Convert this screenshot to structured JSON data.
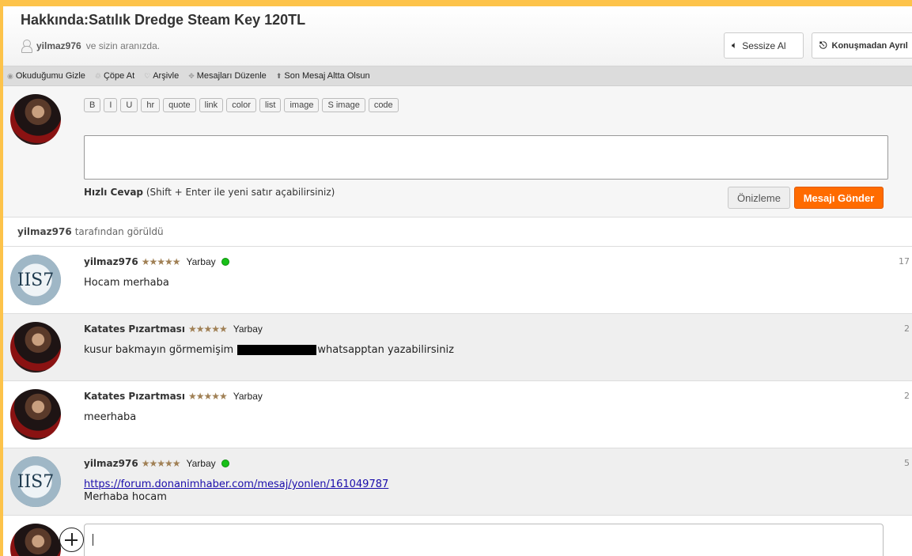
{
  "header": {
    "title": "Hakkında:Satılık Dredge Steam Key 120TL",
    "participant_user": "yilmaz976",
    "participant_suffix": "ve sizin aranızda.",
    "mute_label": "Sessize Al",
    "leave_label": "Konuşmadan Ayrıl"
  },
  "toolbar": {
    "items": [
      {
        "label": "Okuduğumu Gizle",
        "icon": "eye-icon"
      },
      {
        "label": "Çöpe At",
        "icon": "trash-icon"
      },
      {
        "label": "Arşivle",
        "icon": "archive-icon"
      },
      {
        "label": "Mesajları Düzenle",
        "icon": "move-icon"
      },
      {
        "label": "Son Mesaj Altta Olsun",
        "icon": "arrow-up-icon"
      }
    ]
  },
  "composer": {
    "format_buttons": [
      "B",
      "I",
      "U",
      "hr",
      "quote",
      "link",
      "color",
      "list",
      "image",
      "S image",
      "code"
    ],
    "hint_bold": "Hızlı Cevap",
    "hint_rest": "(Shift + Enter ile yeni satır açabilirsiniz)",
    "preview_label": "Önizleme",
    "send_label": "Mesajı Gönder"
  },
  "seen": {
    "user": "yilmaz976",
    "suffix": "tarafından görüldü"
  },
  "messages": [
    {
      "user": "yilmaz976",
      "stars": "★★★★★",
      "rank": "Yarbay",
      "time": "17",
      "body": "Hocam merhaba",
      "online": true
    },
    {
      "user": "Katates Pızartması",
      "stars": "★★★★★",
      "rank": "Yarbay",
      "time": "2",
      "body_before": "kusur bakmayın görmemişim",
      "body_after": "whatsapptan  yazabilirsiniz",
      "online": false
    },
    {
      "user": "Katates Pızartması",
      "stars": "★★★★★",
      "rank": "Yarbay",
      "time": "2",
      "body": "meerhaba",
      "online": false
    },
    {
      "user": "yilmaz976",
      "stars": "★★★★★",
      "rank": "Yarbay",
      "time": "5",
      "link": "https://forum.donanimhaber.com/mesaj/yonlen/161049787",
      "body": "Merhaba hocam",
      "online": true
    }
  ],
  "colors": {
    "accent": "#fdc34a",
    "send_button": "#ff6b00",
    "online": "#18c018",
    "link": "#1a0dab"
  }
}
